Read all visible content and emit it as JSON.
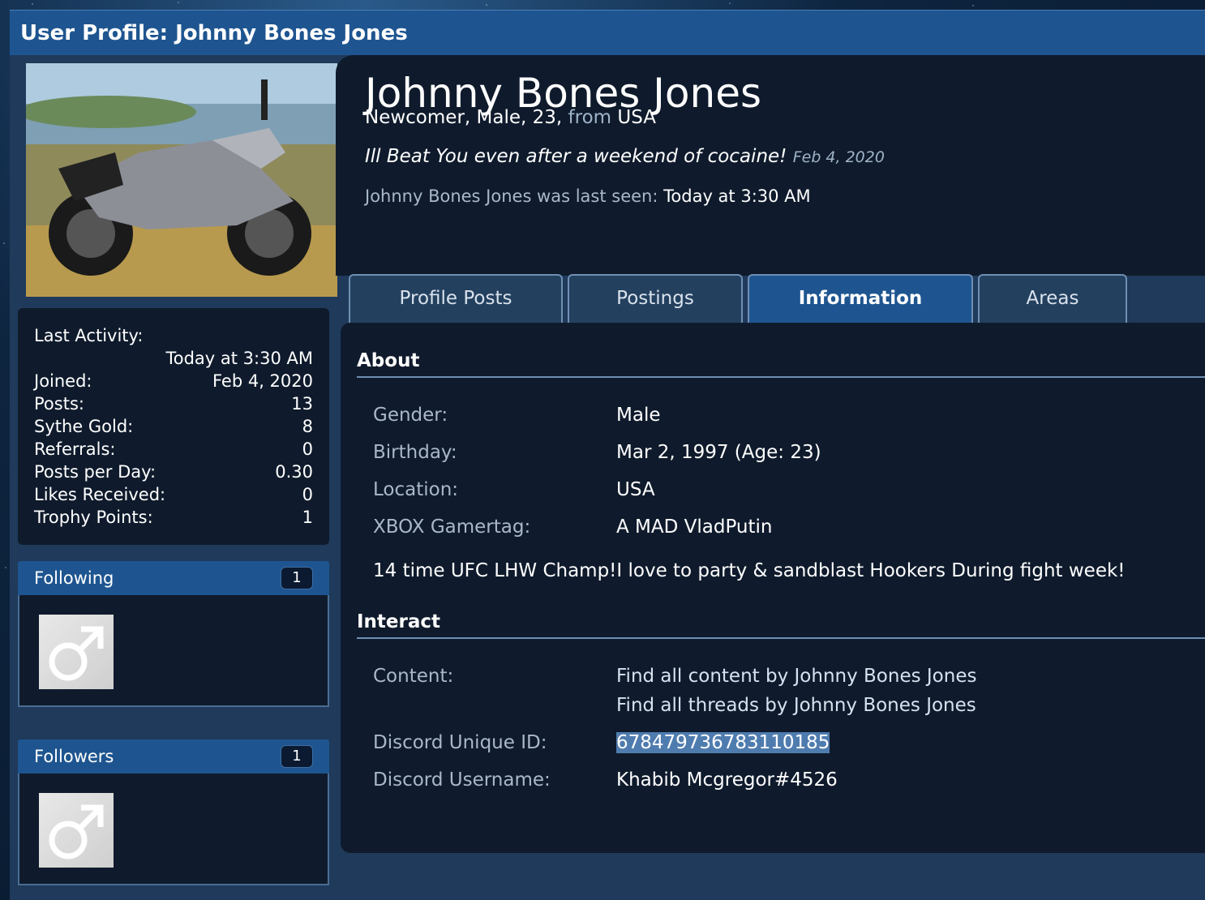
{
  "title_bar": "User Profile: Johnny Bones Jones",
  "profile": {
    "name": "Johnny Bones Jones",
    "meta_prefix": "Newcomer, Male, 23,",
    "meta_from": "from",
    "meta_location": "USA",
    "status_text": "Ill Beat You even after a weekend of cocaine!",
    "status_date": "Feb 4, 2020",
    "last_seen_label": "Johnny Bones Jones was last seen:",
    "last_seen_value": "Today at 3:30 AM"
  },
  "stats": {
    "last_activity_label": "Last Activity:",
    "last_activity_value": "Today at 3:30 AM",
    "rows": [
      {
        "label": "Joined:",
        "value": "Feb 4, 2020"
      },
      {
        "label": "Posts:",
        "value": "13"
      },
      {
        "label": "Sythe Gold:",
        "value": "8"
      },
      {
        "label": "Referrals:",
        "value": "0"
      },
      {
        "label": "Posts per Day:",
        "value": "0.30"
      },
      {
        "label": "Likes Received:",
        "value": "0"
      },
      {
        "label": "Trophy Points:",
        "value": "1"
      }
    ]
  },
  "following": {
    "label": "Following",
    "count": "1"
  },
  "followers": {
    "label": "Followers",
    "count": "1"
  },
  "tabs": [
    {
      "label": "Profile Posts",
      "active": false
    },
    {
      "label": "Postings",
      "active": false
    },
    {
      "label": "Information",
      "active": true
    },
    {
      "label": "Areas",
      "active": false
    }
  ],
  "about": {
    "title": "About",
    "rows": [
      {
        "label": "Gender:",
        "value": "Male"
      },
      {
        "label": "Birthday:",
        "value": "Mar 2, 1997 (Age: 23)"
      },
      {
        "label": "Location:",
        "value": "USA"
      },
      {
        "label": "XBOX Gamertag:",
        "value": "A MAD VladPutin"
      }
    ],
    "bio": "14 time UFC LHW Champ!I love to party & sandblast Hookers During fight week!"
  },
  "interact": {
    "title": "Interact",
    "content_label": "Content:",
    "find_content": "Find all content by Johnny Bones Jones",
    "find_threads": "Find all threads by Johnny Bones Jones",
    "discord_id_label": "Discord Unique ID:",
    "discord_id_value": "678479736783110185",
    "discord_user_label": "Discord Username:",
    "discord_user_value": "Khabib Mcgregor#4526"
  },
  "colors": {
    "header_blue": "#1e5590",
    "panel_dark": "#0f1b2c",
    "page_bg": "#1f3a5a",
    "muted_text": "#a9b8c8",
    "selection": "#4f7caf"
  },
  "icons": {
    "avatar_placeholder": "male-symbol-icon"
  }
}
